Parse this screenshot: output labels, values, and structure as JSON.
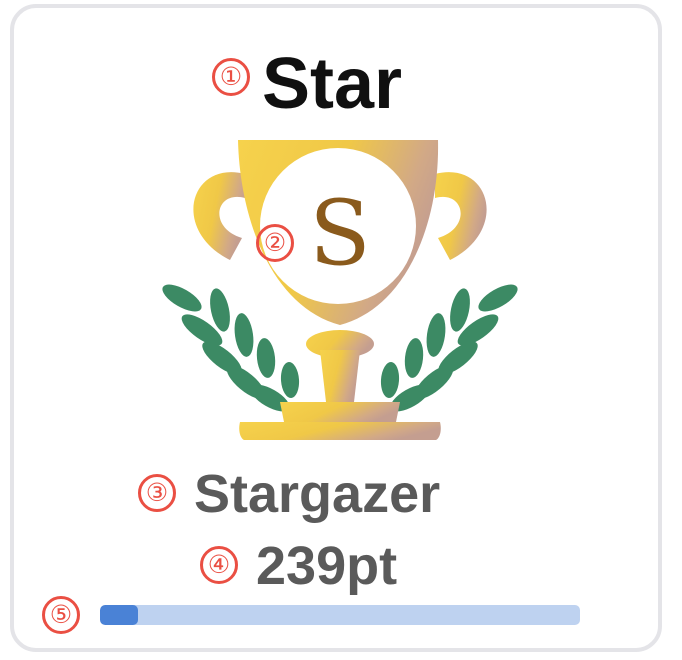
{
  "badge": {
    "rank_title": "Star",
    "emblem_letter": "S",
    "name": "Stargazer",
    "points": "239pt",
    "progress": 0.08
  },
  "markers": [
    "①",
    "②",
    "③",
    "④",
    "⑤"
  ],
  "colors": {
    "gold": "#f3cc45",
    "rose_gold": "#c9a392",
    "laurel": "#3c8a64",
    "letter": "#8a5a1c",
    "marker_red": "#ea4f43",
    "progress_fill": "#4a82d6",
    "progress_track": "#bed2f0"
  }
}
